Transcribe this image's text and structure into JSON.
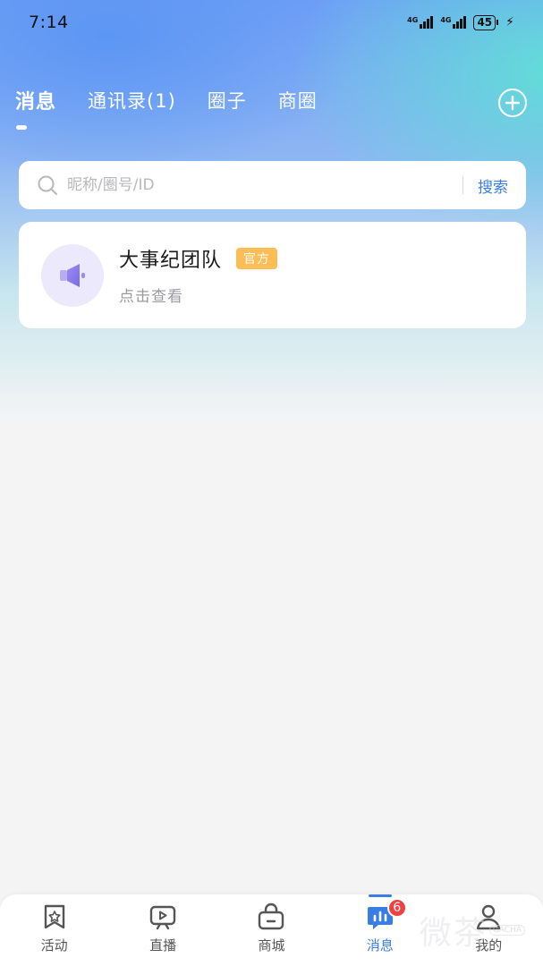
{
  "status_bar": {
    "time": "7:14",
    "signal1_label": "4G",
    "signal2_label": "4G",
    "battery": "45"
  },
  "top_tabs": [
    {
      "label": "消息",
      "active": true
    },
    {
      "label": "通讯录(1)",
      "active": false
    },
    {
      "label": "圈子",
      "active": false
    },
    {
      "label": "商圈",
      "active": false
    }
  ],
  "search": {
    "placeholder": "昵称/圈号/ID",
    "button_label": "搜索"
  },
  "conversations": [
    {
      "title": "大事纪团队",
      "badge": "官方",
      "subtitle": "点击查看",
      "icon": "megaphone-icon"
    }
  ],
  "bottom_nav": {
    "items": [
      {
        "label": "活动",
        "icon": "bookmark-star-icon",
        "active": false
      },
      {
        "label": "直播",
        "icon": "tv-play-icon",
        "active": false
      },
      {
        "label": "商城",
        "icon": "shopping-bag-icon",
        "active": false
      },
      {
        "label": "消息",
        "icon": "chat-bars-icon",
        "active": true,
        "badge": "6"
      },
      {
        "label": "我的",
        "icon": "user-icon",
        "active": false
      }
    ]
  },
  "watermark": {
    "text": "微茶",
    "logo": "GACHA"
  },
  "colors": {
    "accent": "#3a7ee4",
    "badge_official": "#fbbd55",
    "badge_count": "#f04040"
  }
}
